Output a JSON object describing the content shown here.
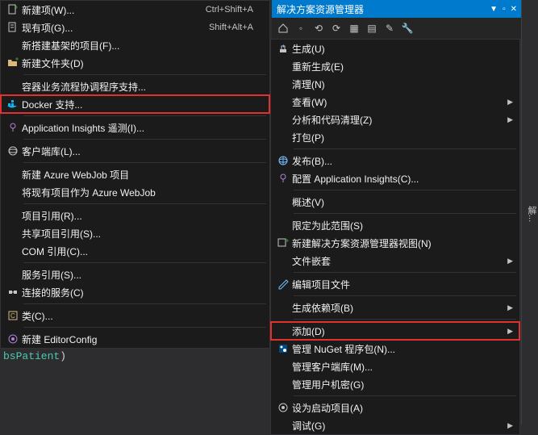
{
  "solutionExplorer": {
    "title": "解决方案资源管理器",
    "sidebarLabel": "解..."
  },
  "leftMenu": {
    "items": [
      {
        "label": "新建项(W)...",
        "shortcut": "Ctrl+Shift+A",
        "icon": "new-item"
      },
      {
        "label": "现有项(G)...",
        "shortcut": "Shift+Alt+A",
        "icon": "existing-item"
      },
      {
        "label": "新搭建基架的项目(F)...",
        "icon": ""
      },
      {
        "label": "新建文件夹(D)",
        "icon": "new-folder"
      },
      {
        "label": "容器业务流程协调程序支持...",
        "icon": ""
      },
      {
        "label": "Docker 支持...",
        "icon": "docker",
        "highlight": true
      },
      {
        "label": "Application Insights 遥测(I)...",
        "icon": "insights"
      },
      {
        "label": "客户端库(L)...",
        "icon": "client-lib"
      },
      {
        "label": "新建 Azure WebJob 项目",
        "icon": ""
      },
      {
        "label": "将现有项目作为 Azure WebJob",
        "icon": ""
      },
      {
        "label": "项目引用(R)...",
        "icon": ""
      },
      {
        "label": "共享项目引用(S)...",
        "icon": ""
      },
      {
        "label": "COM 引用(C)...",
        "icon": ""
      },
      {
        "label": "服务引用(S)...",
        "icon": ""
      },
      {
        "label": "连接的服务(C)",
        "icon": "connected"
      },
      {
        "label": "类(C)...",
        "icon": "class"
      },
      {
        "label": "新建 EditorConfig",
        "icon": "editorconfig"
      }
    ],
    "separatorsAfter": [
      3,
      5,
      6,
      7,
      9,
      12,
      14,
      15
    ]
  },
  "rightMenu": {
    "items": [
      {
        "label": "生成(U)",
        "icon": "build"
      },
      {
        "label": "重新生成(E)",
        "icon": ""
      },
      {
        "label": "清理(N)",
        "icon": ""
      },
      {
        "label": "查看(W)",
        "icon": "",
        "submenu": true
      },
      {
        "label": "分析和代码清理(Z)",
        "icon": "",
        "submenu": true
      },
      {
        "label": "打包(P)",
        "icon": ""
      },
      {
        "label": "发布(B)...",
        "icon": "publish"
      },
      {
        "label": "配置 Application Insights(C)...",
        "icon": "insights"
      },
      {
        "label": "概述(V)",
        "icon": ""
      },
      {
        "label": "限定为此范围(S)",
        "icon": ""
      },
      {
        "label": "新建解决方案资源管理器视图(N)",
        "icon": "new-view"
      },
      {
        "label": "文件嵌套",
        "icon": "",
        "submenu": true
      },
      {
        "label": "编辑项目文件",
        "icon": "edit"
      },
      {
        "label": "生成依赖项(B)",
        "icon": "",
        "submenu": true
      },
      {
        "label": "添加(D)",
        "icon": "",
        "submenu": true,
        "highlight": true
      },
      {
        "label": "管理 NuGet 程序包(N)...",
        "icon": "nuget"
      },
      {
        "label": "管理客户端库(M)...",
        "icon": ""
      },
      {
        "label": "管理用户机密(G)",
        "icon": ""
      },
      {
        "label": "设为启动项目(A)",
        "icon": "startup"
      },
      {
        "label": "调试(G)",
        "icon": "",
        "submenu": true
      }
    ],
    "separatorsAfter": [
      5,
      7,
      8,
      11,
      12,
      13,
      17
    ]
  },
  "codeBehind": {
    "text": "bsPatient",
    "close": ")"
  }
}
